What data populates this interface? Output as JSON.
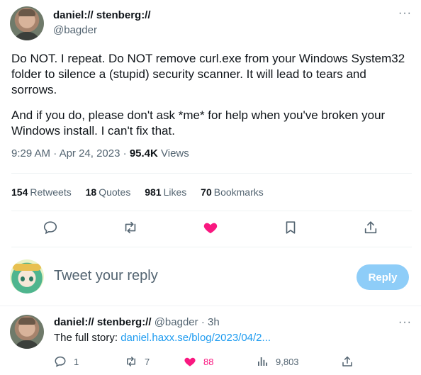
{
  "tweet": {
    "author_name": "daniel:// stenberg://",
    "author_handle": "@bagder",
    "more_label": "···",
    "text_p1": "Do NOT. I repeat. Do NOT remove curl.exe from your Windows System32 folder to silence a (stupid) security scanner. It will lead to tears and sorrows.",
    "text_p2": "And if you do, please don't ask *me* for help when you've broken your Windows install. I can't fix that.",
    "time": "9:29 AM",
    "date": "Apr 24, 2023",
    "separator": "·",
    "views_count": "95.4K",
    "views_label": "Views"
  },
  "stats": [
    {
      "count": "154",
      "label": "Retweets"
    },
    {
      "count": "18",
      "label": "Quotes"
    },
    {
      "count": "981",
      "label": "Likes"
    },
    {
      "count": "70",
      "label": "Bookmarks"
    }
  ],
  "actions": [
    {
      "icon": "reply-icon"
    },
    {
      "icon": "retweet-icon"
    },
    {
      "icon": "heart-icon-filled",
      "color": "#f91880"
    },
    {
      "icon": "bookmark-icon"
    },
    {
      "icon": "share-icon"
    }
  ],
  "compose": {
    "placeholder": "Tweet your reply",
    "button_label": "Reply",
    "button_color": "#8ecdf8"
  },
  "reply": {
    "author_name": "daniel:// stenberg://",
    "author_handle": "@bagder",
    "time_sep": "·",
    "time": "3h",
    "more_label": "···",
    "text_prefix": "The full story: ",
    "link": "daniel.haxx.se/blog/2023/04/2...",
    "link_color": "#1d9bf0",
    "actions": {
      "replies": "1",
      "retweets": "7",
      "likes": "88",
      "likes_color": "#f91880",
      "views": "9,803"
    }
  },
  "colors": {
    "text": "#0f1419",
    "secondary": "#536471",
    "divider": "#eff3f4"
  }
}
